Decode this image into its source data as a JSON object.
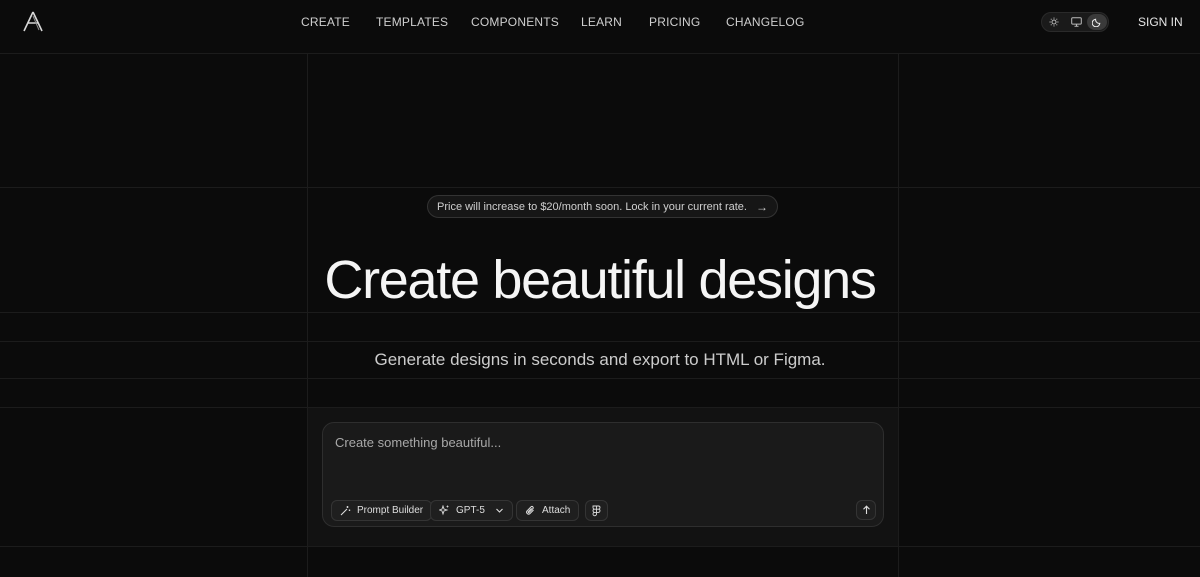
{
  "nav": {
    "items": [
      {
        "label": "CREATE"
      },
      {
        "label": "TEMPLATES"
      },
      {
        "label": "COMPONENTS"
      },
      {
        "label": "LEARN"
      },
      {
        "label": "PRICING"
      },
      {
        "label": "CHANGELOG"
      }
    ],
    "theme_options": [
      "sun-icon",
      "monitor-icon",
      "moon-icon"
    ],
    "active_theme": "moon-icon",
    "signin_label": "SIGN IN"
  },
  "banner": {
    "text": "Price will increase to $20/month soon. Lock in your current rate.",
    "arrow": "→"
  },
  "hero": {
    "headline": "Create beautiful designs",
    "subtitle": "Generate designs in seconds and export to HTML or Figma."
  },
  "composer": {
    "placeholder": "Create something beautiful...",
    "prompt_builder_label": "Prompt Builder",
    "model_label": "GPT-5",
    "attach_label": "Attach"
  },
  "colors": {
    "background": "#0b0b0b",
    "text": "#f5f5f5",
    "muted": "#cccccc"
  }
}
